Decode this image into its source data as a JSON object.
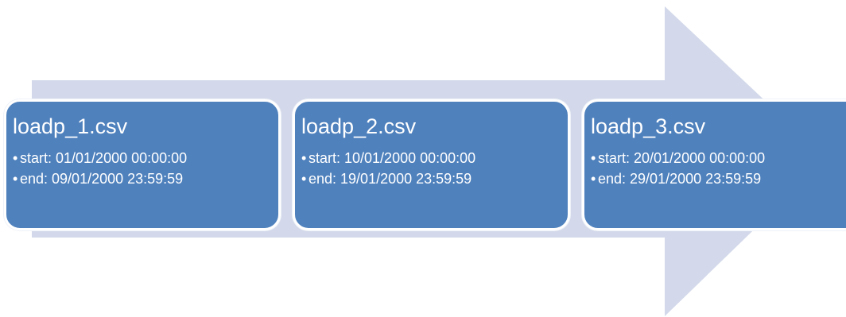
{
  "colors": {
    "arrow": "#d3d9ea",
    "card_fill": "#4f81bd",
    "card_border": "#ffffff",
    "text": "#ffffff"
  },
  "cards": [
    {
      "title": "loadp_1.csv",
      "bullet": "•",
      "start": "start: 01/01/2000 00:00:00",
      "end": "end: 09/01/2000 23:59:59"
    },
    {
      "title": "loadp_2.csv",
      "bullet": "•",
      "start": "start: 10/01/2000 00:00:00",
      "end": "end: 19/01/2000 23:59:59"
    },
    {
      "title": "loadp_3.csv",
      "bullet": "•",
      "start": "start: 20/01/2000 00:00:00",
      "end": "end: 29/01/2000 23:59:59"
    }
  ]
}
